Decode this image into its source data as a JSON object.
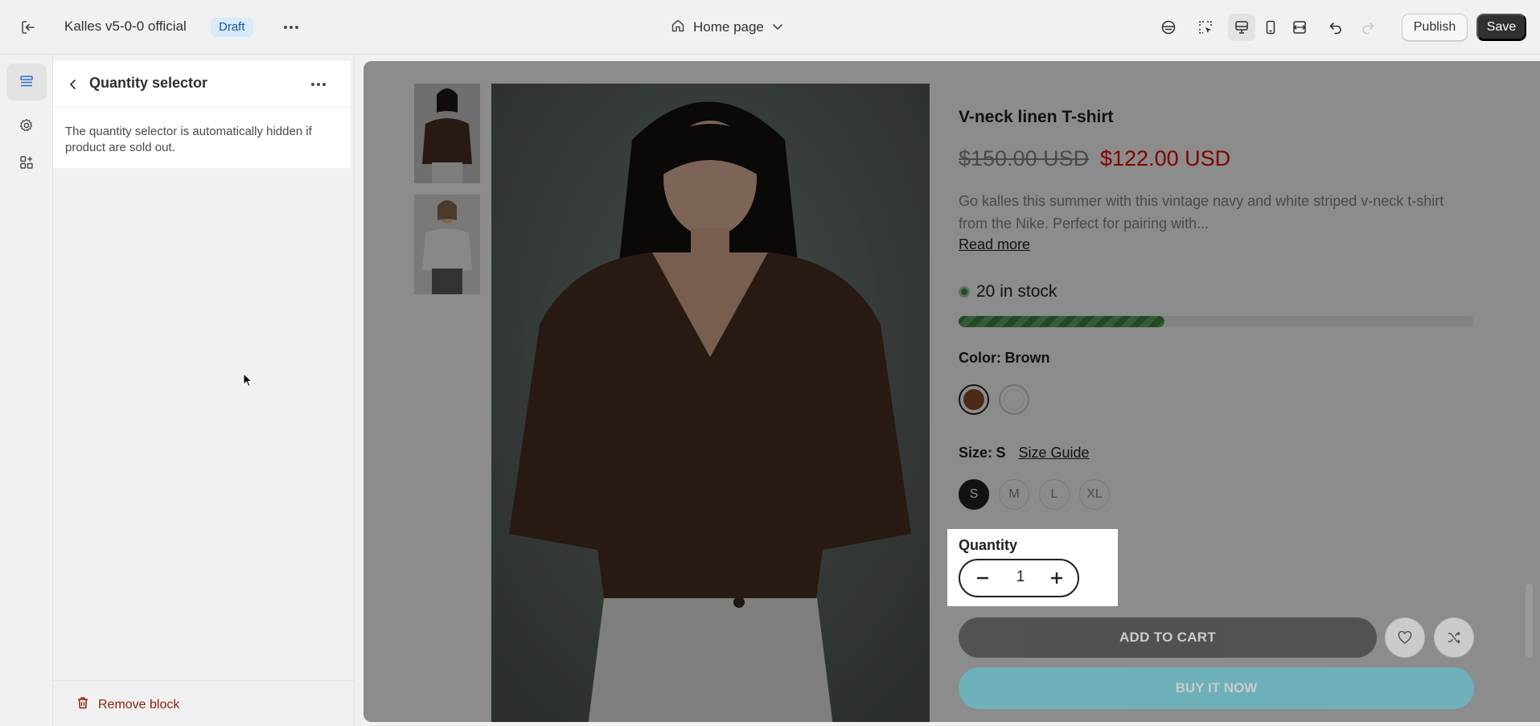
{
  "topbar": {
    "store_name": "Kalles v5-0-0 official",
    "status_badge": "Draft",
    "page_selector": "Home page",
    "publish_label": "Publish",
    "save_label": "Save",
    "icons": [
      "exit-icon",
      "more-icon",
      "home-icon",
      "chevron-down-icon",
      "app-embed-icon",
      "inspector-icon",
      "desktop-icon",
      "mobile-icon",
      "fullwidth-icon",
      "undo-icon",
      "redo-icon"
    ]
  },
  "rail": {
    "items": [
      {
        "name": "sections",
        "icon": "sections-icon",
        "active": true
      },
      {
        "name": "theme-settings",
        "icon": "gear-icon",
        "active": false
      },
      {
        "name": "app-embeds",
        "icon": "apps-icon",
        "active": false
      }
    ]
  },
  "panel": {
    "title": "Quantity selector",
    "description": "The quantity selector is automatically hidden if product are sold out.",
    "remove_label": "Remove block"
  },
  "product": {
    "title": "V-neck linen T-shirt",
    "compare_price": "$150.00 USD",
    "price": "$122.00 USD",
    "description": "Go kalles this summer with this vintage navy and white striped v-neck t-shirt from the Nike. Perfect for pairing with...",
    "read_more": "Read more",
    "stock_text": "20 in stock",
    "stock_fraction": 0.4,
    "color_label": "Color:",
    "color_value": "Brown",
    "colors": [
      {
        "name": "Brown",
        "hex": "#8b4a2b",
        "selected": true
      },
      {
        "name": "White",
        "hex": "#ffffff",
        "selected": false
      }
    ],
    "size_label": "Size:",
    "size_value": "S",
    "size_guide": "Size Guide",
    "sizes": [
      "S",
      "M",
      "L",
      "XL"
    ],
    "quantity_label": "Quantity",
    "quantity_value": "1",
    "add_to_cart": "ADD TO CART",
    "buy_now": "BUY IT NOW"
  },
  "colors": {
    "accent_badge_bg": "#d5ebff",
    "price_red": "#ec0101",
    "buy_now_bg": "#56cfe1",
    "remove_red": "#8e1f0b"
  }
}
